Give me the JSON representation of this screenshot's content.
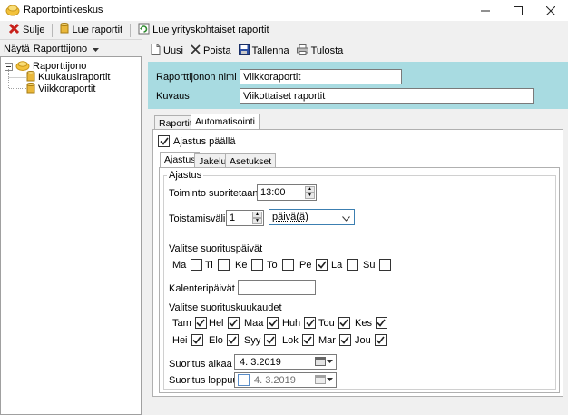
{
  "window": {
    "title": "Raportointikeskus"
  },
  "toolbar": {
    "close_label": "Sulje",
    "read_reports_label": "Lue raportit",
    "read_company_reports_label": "Lue yrityskohtaiset raportit"
  },
  "left": {
    "show_label": "Näytä",
    "view_dropdown": "Raporttijono",
    "tree": {
      "root": "Raporttijono",
      "children": [
        "Kuukausiraportit",
        "Viikkoraportit"
      ]
    }
  },
  "actions": {
    "new_label": "Uusi",
    "delete_label": "Poista",
    "save_label": "Tallenna",
    "print_label": "Tulosta"
  },
  "header": {
    "name_label": "Raporttijonon nimi",
    "name_value": "Viikkoraportit",
    "desc_label": "Kuvaus",
    "desc_value": "Viikottaiset raportit"
  },
  "tabs": {
    "outer": [
      "Raportit",
      "Automatisointi"
    ],
    "outer_active": "Automatisointi",
    "inner": [
      "Ajastus",
      "Jakelu",
      "Asetukset"
    ],
    "inner_active": "Ajastus"
  },
  "schedule": {
    "enabled_label": "Ajastus päällä",
    "enabled": true,
    "group_title": "Ajastus",
    "run_at_label": "Toiminto suoritetaan klo",
    "run_at_value": "13:00",
    "interval_label": "Toistamisväli:",
    "interval_value": "1",
    "interval_unit": "päivä(ä)",
    "weekdays_label": "Valitse suorituspäivät",
    "weekdays": [
      {
        "label": "Ma",
        "checked": false
      },
      {
        "label": "Ti",
        "checked": false
      },
      {
        "label": "Ke",
        "checked": false
      },
      {
        "label": "To",
        "checked": false
      },
      {
        "label": "Pe",
        "checked": true
      },
      {
        "label": "La",
        "checked": false
      },
      {
        "label": "Su",
        "checked": false
      }
    ],
    "calendar_days_label": "Kalenteripäivät",
    "calendar_days_value": "",
    "months_label": "Valitse suorituskuukaudet",
    "months": [
      {
        "label": "Tam",
        "checked": true
      },
      {
        "label": "Hel",
        "checked": true
      },
      {
        "label": "Maa",
        "checked": true
      },
      {
        "label": "Huh",
        "checked": true
      },
      {
        "label": "Tou",
        "checked": true
      },
      {
        "label": "Kes",
        "checked": true
      },
      {
        "label": "Hei",
        "checked": true
      },
      {
        "label": "Elo",
        "checked": true
      },
      {
        "label": "Syy",
        "checked": true
      },
      {
        "label": "Lok",
        "checked": true
      },
      {
        "label": "Mar",
        "checked": true
      },
      {
        "label": "Jou",
        "checked": true
      }
    ],
    "start_label": "Suoritus alkaa",
    "start_value": "4.  3.2019",
    "end_label": "Suoritus loppuu",
    "end_value": "4.  3.2019",
    "end_enabled": false
  }
}
